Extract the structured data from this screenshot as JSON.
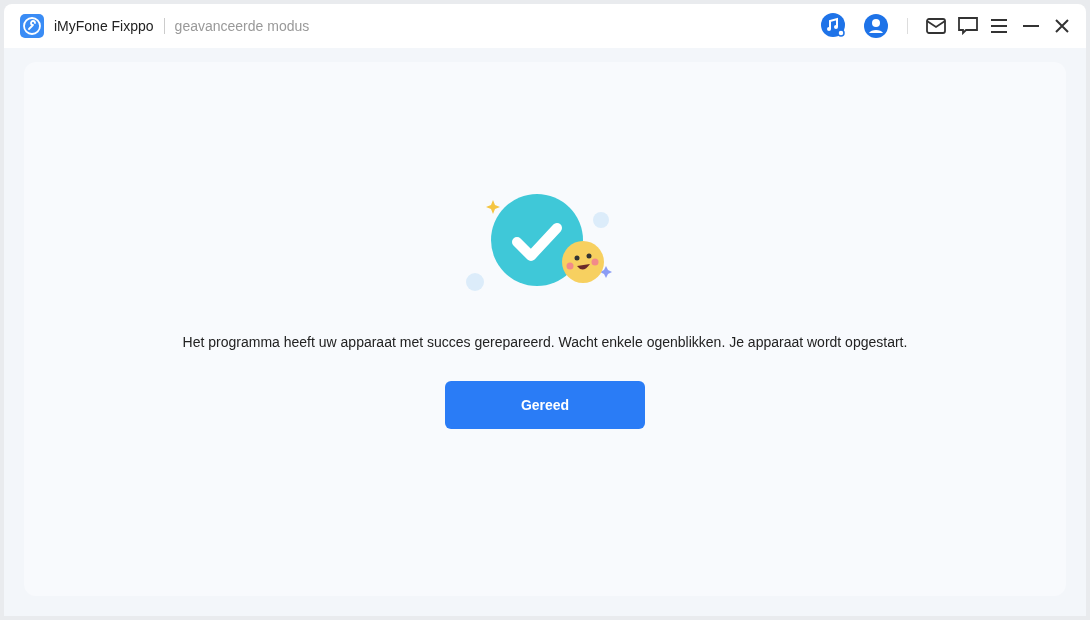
{
  "window": {
    "title": "iMyFone Fixppo",
    "mode": "geavanceerde modus"
  },
  "message": "Het programma heeft uw apparaat met succes gerepareerd. Wacht enkele ogenblikken. Je apparaat wordt opgestart.",
  "buttons": [
    "Gereed"
  ]
}
